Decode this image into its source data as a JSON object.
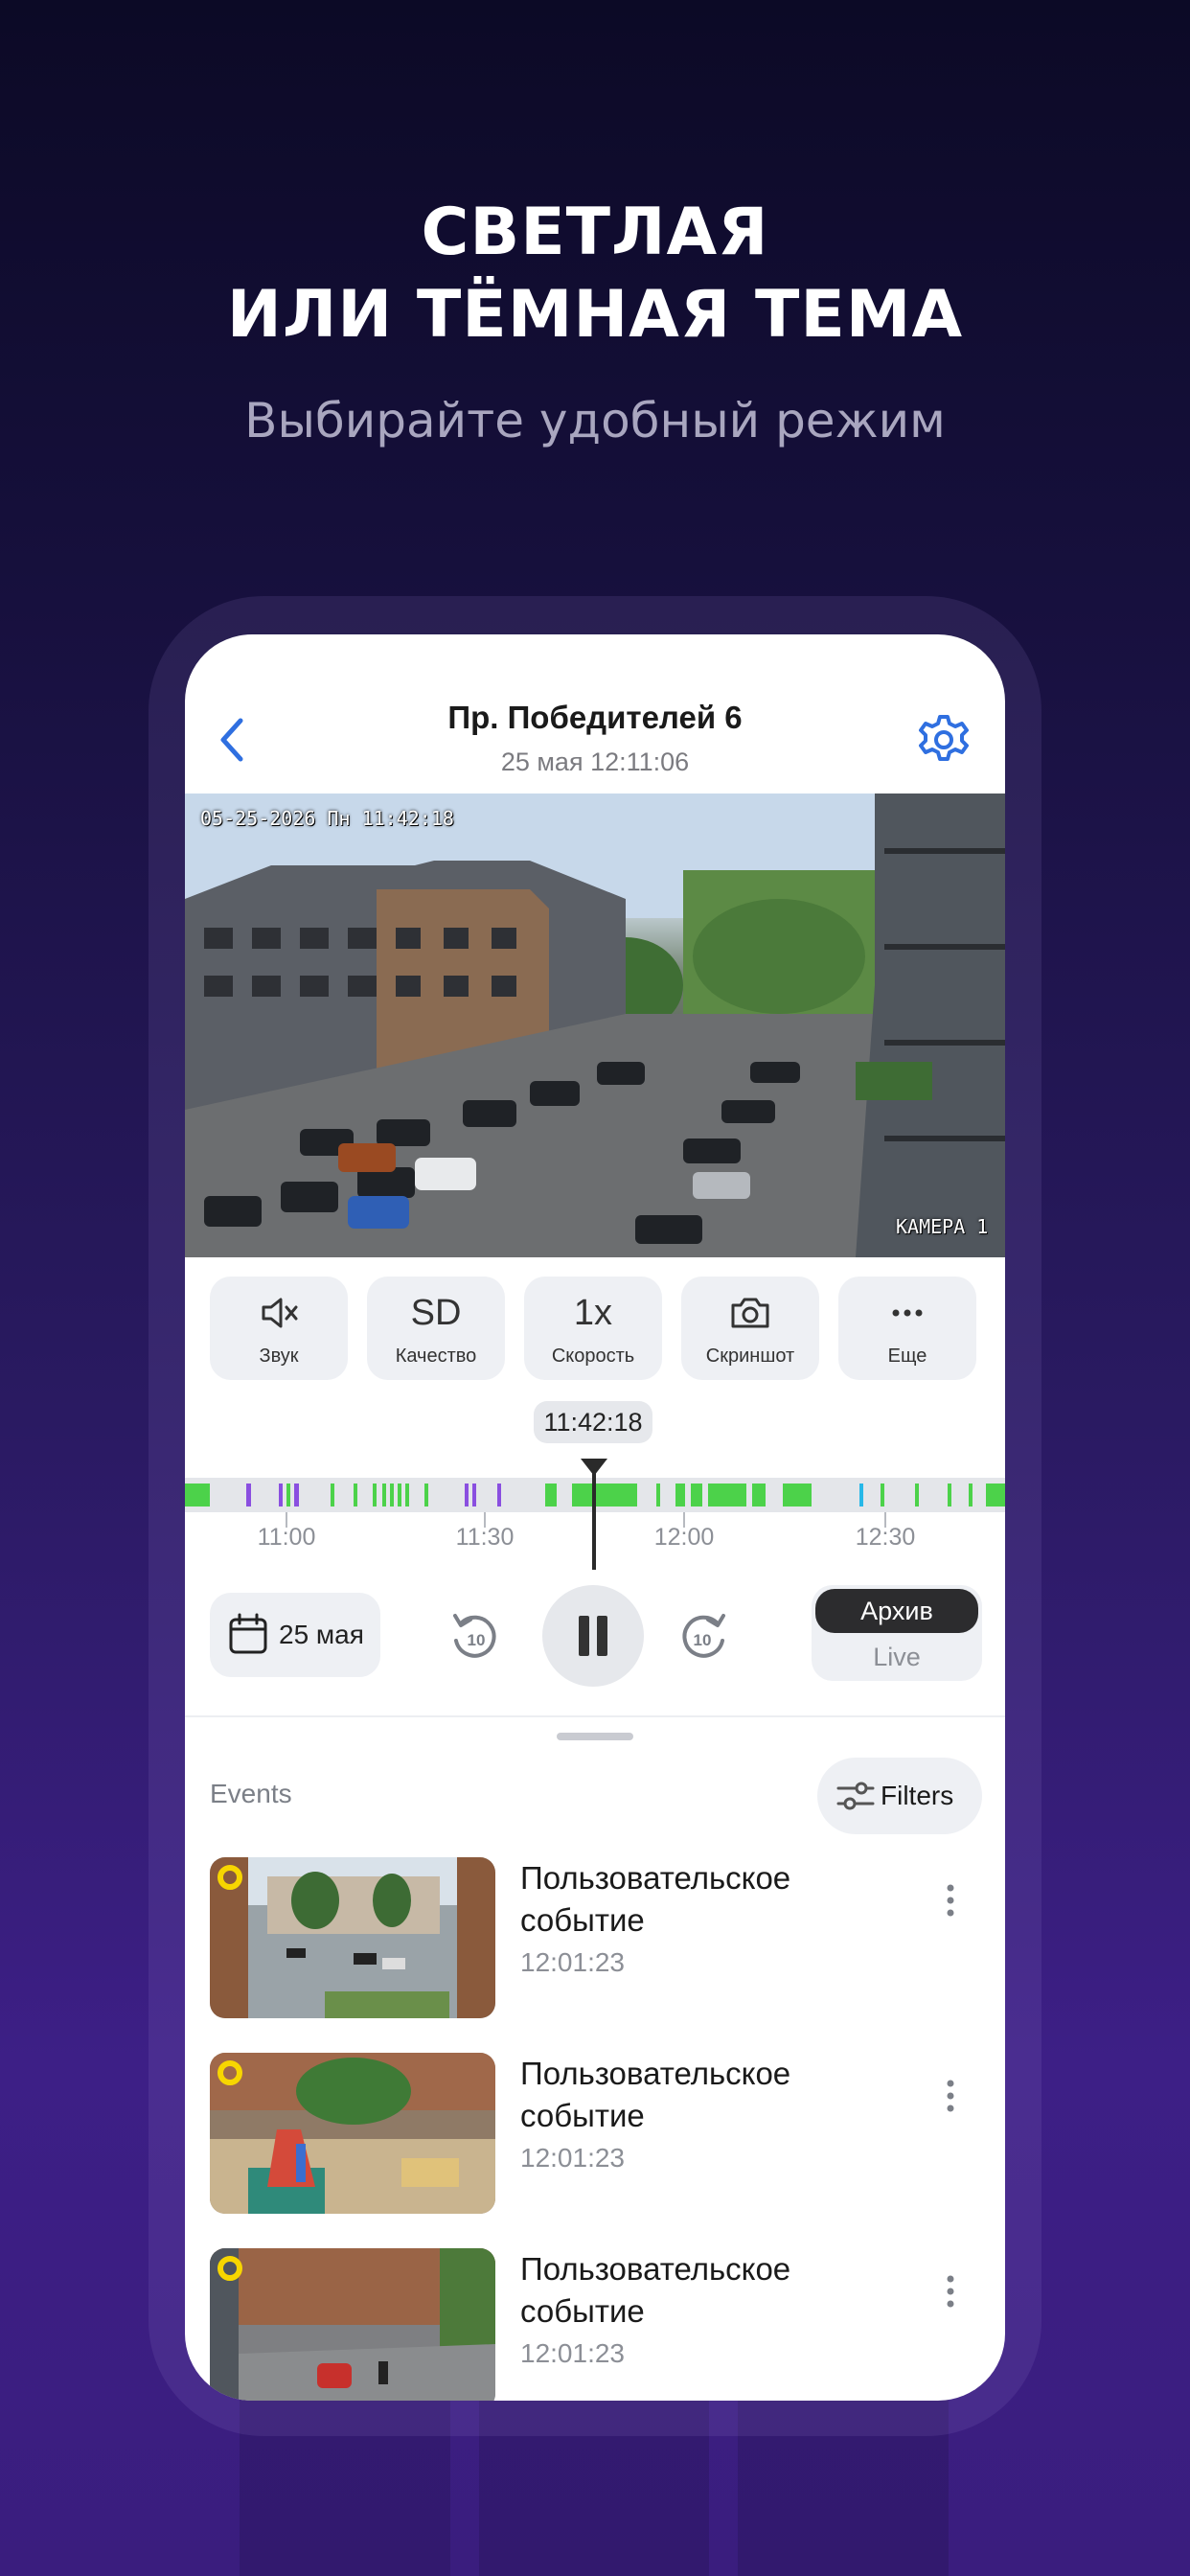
{
  "promo": {
    "headline_line1": "СВЕТЛАЯ",
    "headline_line2": "ИЛИ ТЁМНАЯ ТЕМА",
    "subtitle": "Выбирайте удобный режим"
  },
  "header": {
    "title": "Пр. Победителей 6",
    "subtitle": "25 мая 12:11:06"
  },
  "video": {
    "osd_timestamp": "05-25-2026 Пн 11:42:18",
    "osd_camera": "КАМЕРА 1"
  },
  "controls": [
    {
      "icon": "mute-icon",
      "value": "",
      "label": "Звук"
    },
    {
      "icon": "",
      "value": "SD",
      "label": "Качество"
    },
    {
      "icon": "",
      "value": "1x",
      "label": "Скорость"
    },
    {
      "icon": "camera-icon",
      "value": "",
      "label": "Скриншот"
    },
    {
      "icon": "more-horizontal-icon",
      "value": "",
      "label": "Еще"
    }
  ],
  "timeline": {
    "current_time": "11:42:18",
    "tick_labels": [
      "11:00",
      "11:30",
      "12:00",
      "12:30"
    ]
  },
  "player": {
    "date_label": "25 мая",
    "skip_back": "10",
    "skip_forward": "10",
    "mode_selected": "Архив",
    "mode_other": "Live"
  },
  "events": {
    "section_label": "Events",
    "filters_label": "Filters",
    "items": [
      {
        "title": "Пользовательское событие",
        "time": "12:01:23"
      },
      {
        "title": "Пользовательское событие",
        "time": "12:01:23"
      },
      {
        "title": "Пользовательское событие",
        "time": "12:01:23"
      }
    ]
  },
  "colors": {
    "accent_blue": "#2f6fe0",
    "motion_green": "#4cd24a",
    "event_purple": "#8a4fe0",
    "event_cyan": "#27b8e8",
    "marker_yellow": "#f7d600"
  }
}
